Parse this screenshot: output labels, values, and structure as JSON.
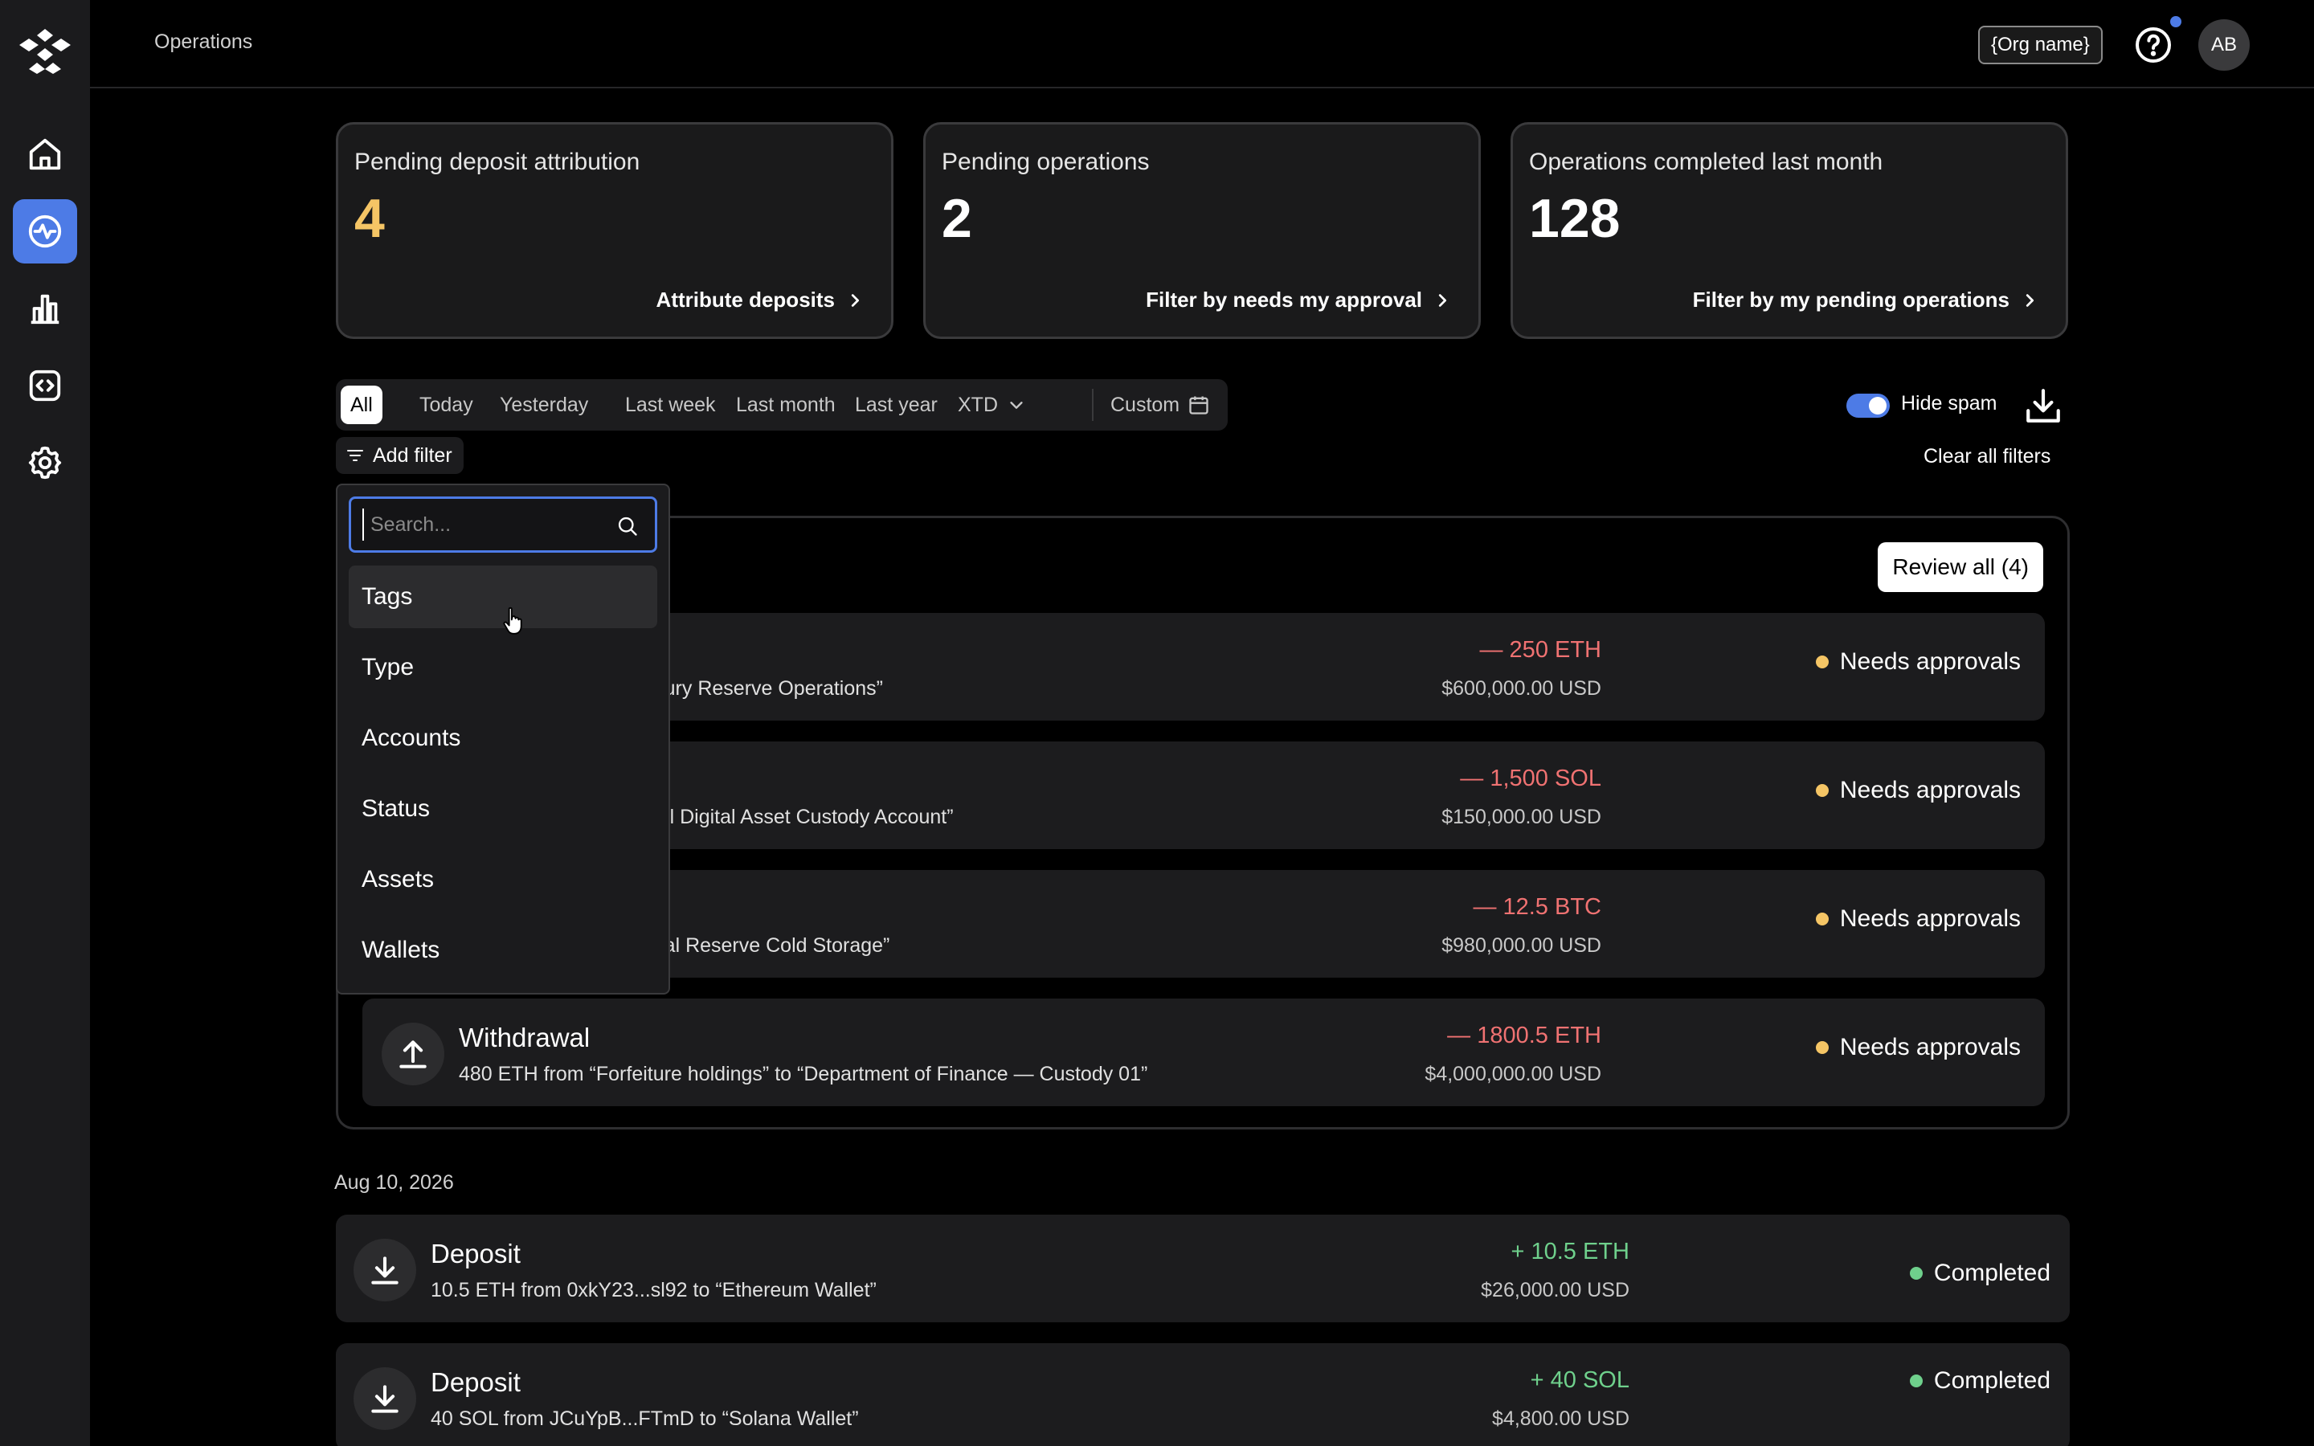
{
  "header": {
    "page_title": "Operations",
    "org_name": "{Org name}",
    "avatar_initials": "AB"
  },
  "sidebar": {
    "items": [
      {
        "icon": "home-icon",
        "active": false
      },
      {
        "icon": "activity-icon",
        "active": true
      },
      {
        "icon": "bar-chart-icon",
        "active": false
      },
      {
        "icon": "code-icon",
        "active": false
      },
      {
        "icon": "gear-icon",
        "active": false
      }
    ]
  },
  "stats": [
    {
      "title": "Pending deposit attribution",
      "value": "4",
      "link": "Attribute deposits",
      "accent": "#f5c565"
    },
    {
      "title": "Pending operations",
      "value": "2",
      "link": "Filter by needs my approval"
    },
    {
      "title": "Operations completed last month",
      "value": "128",
      "link": "Filter by my pending operations"
    }
  ],
  "date_filters": {
    "items": [
      "All",
      "Today",
      "Yesterday",
      "Last week",
      "Last month",
      "Last year",
      "XTD",
      "Custom"
    ],
    "selected": "All"
  },
  "toolbar": {
    "add_filter": "Add filter",
    "hide_spam": "Hide spam",
    "hide_spam_on": true,
    "clear_filters": "Clear all filters"
  },
  "pending_group": {
    "review_all": "Review all (4)",
    "rows": [
      {
        "type": "",
        "desc": "ons vault” to “US Treasury Reserve Operations”",
        "amount": "— 250 ETH",
        "usd": "$600,000.00 USD",
        "status": "Needs approvals"
      },
      {
        "type": "",
        "desc": " assets vault” to “Federal Digital Asset Custody Account”",
        "amount": "— 1,500 SOL",
        "usd": "$150,000.00 USD",
        "status": "Needs approvals"
      },
      {
        "type": "",
        "desc": "assets vault” to “National Reserve Cold Storage”",
        "amount": "— 12.5 BTC",
        "usd": "$980,000.00 USD",
        "status": "Needs approvals"
      },
      {
        "type": "Withdrawal",
        "desc": "480 ETH from “Forfeiture holdings” to “Department of Finance — Custody 01”",
        "amount": "— 1800.5 ETH",
        "usd": "$4,000,000.00 USD",
        "status": "Needs approvals"
      }
    ]
  },
  "history": {
    "date": "Aug 10, 2026",
    "rows": [
      {
        "type": "Deposit",
        "desc": "10.5 ETH from 0xkY23...sl92 to “Ethereum Wallet”",
        "amount": "+ 10.5 ETH",
        "usd": "$26,000.00 USD",
        "status": "Completed"
      },
      {
        "type": "Deposit",
        "desc": "40 SOL from JCuYpB...FTmD to “Solana Wallet”",
        "amount": "+ 40 SOL",
        "usd": "$4,800.00 USD",
        "status": "Completed"
      }
    ]
  },
  "filter_dropdown": {
    "search_placeholder": "Search...",
    "search_value": "",
    "items": [
      "Tags",
      "Type",
      "Accounts",
      "Status",
      "Assets",
      "Wallets"
    ],
    "hovered": "Tags"
  },
  "colors": {
    "accent": "#4d7be6",
    "pending": "#f5c565",
    "negative": "#f07272",
    "positive": "#6fd08c"
  }
}
